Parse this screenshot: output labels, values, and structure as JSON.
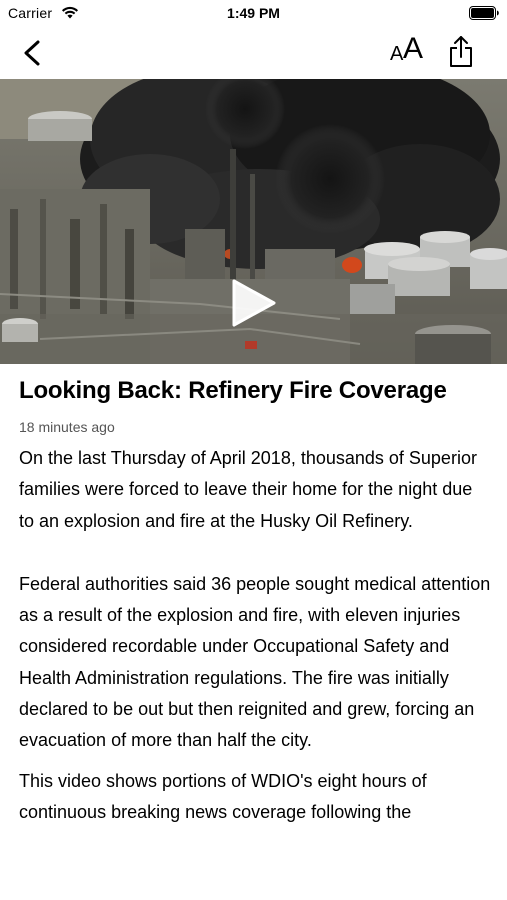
{
  "status_bar": {
    "carrier": "Carrier",
    "time": "1:49 PM"
  },
  "nav": {
    "text_size_small": "A",
    "text_size_large": "A",
    "icons": [
      "chevron-left-icon",
      "text-size-icon",
      "share-icon"
    ]
  },
  "video": {
    "icon": "play-icon"
  },
  "article": {
    "headline": "Looking Back: Refinery Fire Coverage",
    "timestamp": "18 minutes ago",
    "paragraphs": [
      "On the last Thursday of April 2018, thousands of Superior families were forced to leave their home for the night due to an explosion and fire at the Husky Oil Refinery.",
      "Federal authorities said 36 people sought medical attention as a result of the explosion and fire, with eleven injuries considered recordable under Occupational Safety and Health Administration regulations. The fire was initially declared to be out but then reignited and grew, forcing an evacuation of more than half the city.",
      "This video shows portions of WDIO's eight hours of continuous breaking news coverage following the"
    ]
  },
  "colors": {
    "text": "#000000",
    "secondary_text": "#555555",
    "background": "#ffffff"
  }
}
